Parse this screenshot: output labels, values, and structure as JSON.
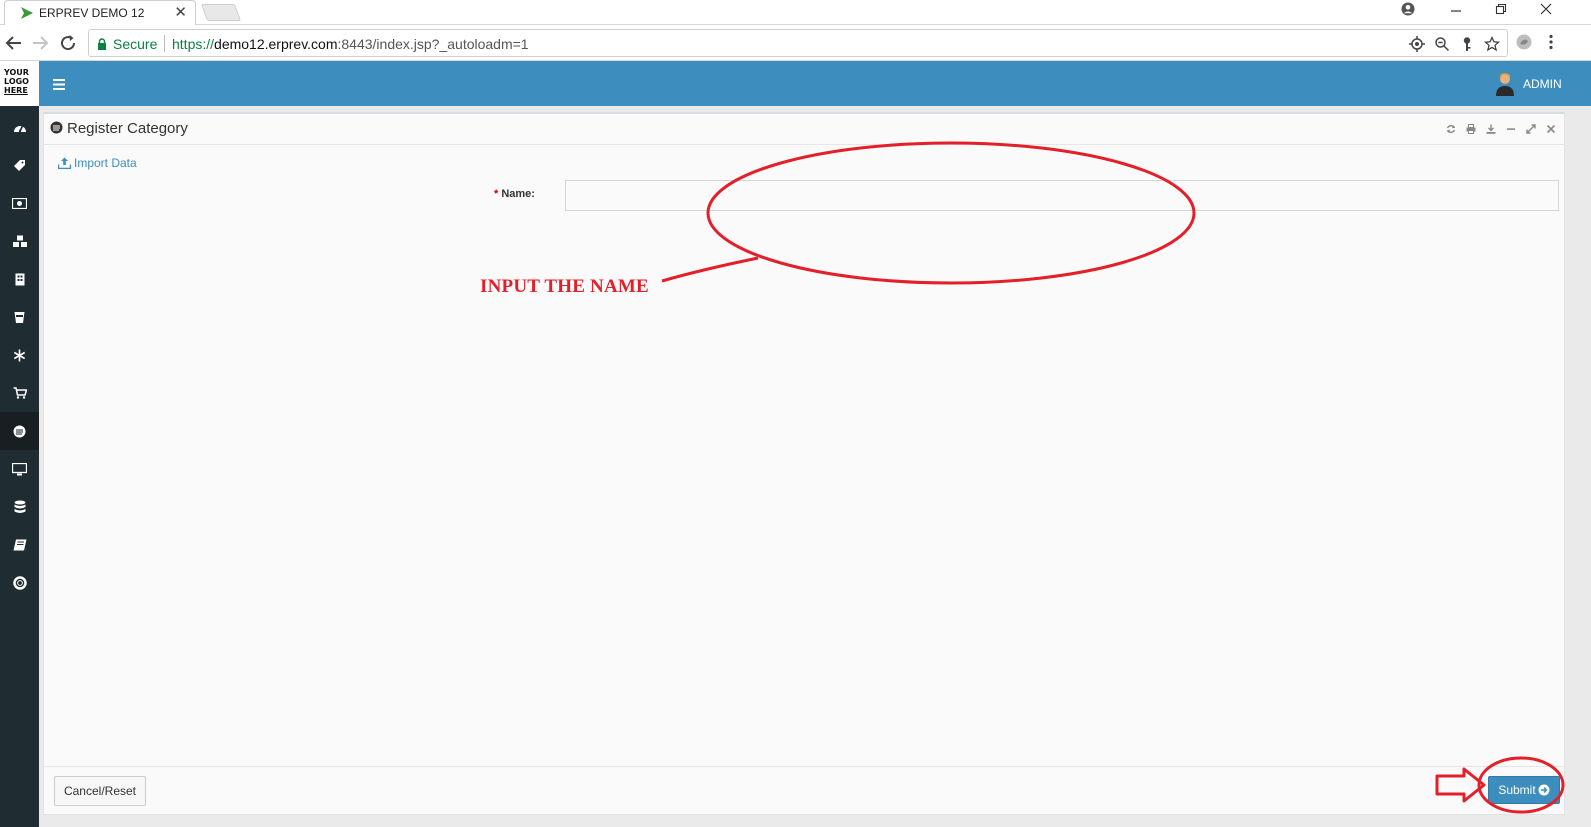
{
  "browser": {
    "tab_title": "ERPREV DEMO 12",
    "secure_label": "Secure",
    "url_scheme": "https://",
    "url_host": "demo12.erprev.com",
    "url_rest": ":8443/index.jsp?_autoloadm=1"
  },
  "sidebar": {
    "logo_lines": [
      "YOUR",
      "LOGO",
      "HERE"
    ],
    "items": [
      {
        "icon": "dashboard-icon"
      },
      {
        "icon": "tag-icon"
      },
      {
        "icon": "money-icon"
      },
      {
        "icon": "cubes-icon"
      },
      {
        "icon": "building-icon"
      },
      {
        "icon": "cup-icon"
      },
      {
        "icon": "snowflake-icon"
      },
      {
        "icon": "cart-icon"
      },
      {
        "icon": "category-icon",
        "active": true
      },
      {
        "icon": "monitor-icon"
      },
      {
        "icon": "database-icon"
      },
      {
        "icon": "book-icon"
      },
      {
        "icon": "lifebuoy-icon"
      }
    ]
  },
  "header": {
    "user_name": "ADMIN"
  },
  "panel": {
    "title": "Register Category",
    "import_label": "Import Data",
    "name_required_mark": "*",
    "name_label": "Name:",
    "name_value": "",
    "cancel_label": "Cancel/Reset",
    "submit_label": "Submit"
  },
  "annotation": {
    "text": "INPUT THE NAME",
    "color": "#e3202a"
  },
  "colors": {
    "header": "#3d8ebf",
    "sidebar": "#1f2d33",
    "accent": "#3d8ebf"
  }
}
